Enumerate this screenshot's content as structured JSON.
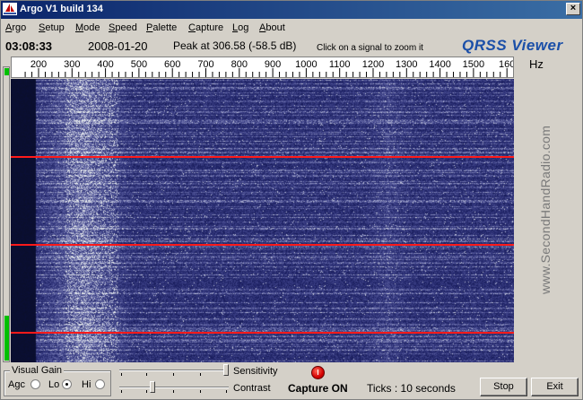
{
  "window": {
    "title": "Argo V1 build 134",
    "close_glyph": "×"
  },
  "menu": [
    "Argo",
    "Setup",
    "Mode",
    "Speed",
    "Palette",
    "Capture",
    "Log",
    "About"
  ],
  "info": {
    "time": "03:08:33",
    "date": "2008-01-20",
    "peak": "Peak at  306.58  (-58.5 dB)",
    "hint": "Click on a signal to zoom it",
    "logo": "QRSS Viewer"
  },
  "ruler": {
    "labels": [
      "200",
      "300",
      "400",
      "500",
      "600",
      "700",
      "800",
      "900",
      "1000",
      "1100",
      "1200",
      "1300",
      "1400",
      "1500",
      "160"
    ],
    "unit": "Hz"
  },
  "watermark": "www.SecondHandRadio.com",
  "controls": {
    "visual_gain": "Visual Gain",
    "agc": "Agc",
    "lo": "Lo",
    "hi": "Hi",
    "selected": "Lo",
    "sensitivity": "Sensitivity",
    "contrast": "Contrast",
    "capture": "Capture ON",
    "ticks": "Ticks  : 10 seconds",
    "stop": "Stop",
    "exit": "Exit"
  },
  "colors": {
    "title_bar": "#0a246a",
    "marker": "#ff1a1a",
    "led": "#d40000",
    "level": "#00c000",
    "logo": "#1b4fa8"
  },
  "icons": {
    "app": "sailboat-icon",
    "close": "close-icon"
  }
}
